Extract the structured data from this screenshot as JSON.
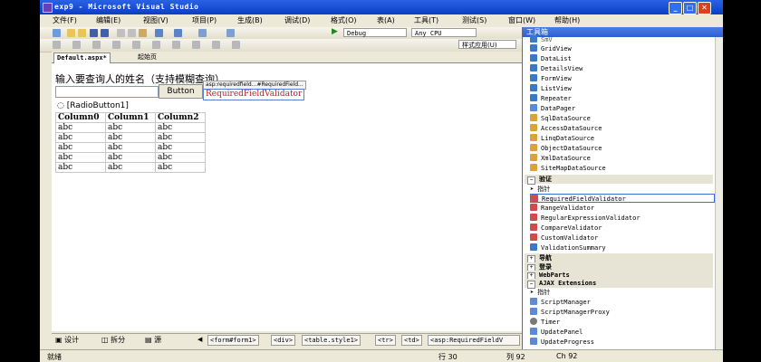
{
  "window": {
    "title": "exp9 - Microsoft Visual Studio"
  },
  "menu": [
    "文件(F)",
    "编辑(E)",
    "视图(V)",
    "项目(P)",
    "生成(B)",
    "调试(D)",
    "格式(O)",
    "表(A)",
    "工具(T)",
    "测试(S)",
    "窗口(W)",
    "帮助(H)"
  ],
  "toolbar": {
    "config": "Debug",
    "platform": "Any CPU",
    "style_app": "样式应用(U)"
  },
  "tabs": [
    "Default.aspx*",
    "起始页"
  ],
  "design": {
    "prompt": "输入要查询人的姓名（支持模糊查询）",
    "button": "Button",
    "validator_tag": "asp:requiredfield...#RequiredField...",
    "validator_text": "RequiredFieldValidator",
    "radio": "[RadioButton1]",
    "table_headers": [
      "Column0",
      "Column1",
      "Column2"
    ],
    "table_rows": [
      [
        "abc",
        "abc",
        "abc"
      ],
      [
        "abc",
        "abc",
        "abc"
      ],
      [
        "abc",
        "abc",
        "abc"
      ],
      [
        "abc",
        "abc",
        "abc"
      ],
      [
        "abc",
        "abc",
        "abc"
      ]
    ]
  },
  "view_tabs": [
    "设计",
    "拆分",
    "源"
  ],
  "breadcrumbs": [
    "<form#form1>",
    "<div>",
    "<table.style1>",
    "<tr>",
    "<td>",
    "<asp:RequiredFieldV"
  ],
  "status": {
    "ready": "就绪",
    "line": "行 30",
    "col": "列 92",
    "ch": "Ch 92"
  },
  "toolbox": {
    "title": "工具箱",
    "partial_top": "SmV",
    "data_items": [
      {
        "label": "GridView",
        "color": "#3a78c8"
      },
      {
        "label": "DataList",
        "color": "#3a78c8"
      },
      {
        "label": "DetailsView",
        "color": "#3a78c8"
      },
      {
        "label": "FormView",
        "color": "#3a78c8"
      },
      {
        "label": "ListView",
        "color": "#3a78c8"
      },
      {
        "label": "Repeater",
        "color": "#3a78c8"
      },
      {
        "label": "DataPager",
        "color": "#5a8ad8"
      },
      {
        "label": "SqlDataSource",
        "color": "#d9a23a"
      },
      {
        "label": "AccessDataSource",
        "color": "#d9a23a"
      },
      {
        "label": "LinqDataSource",
        "color": "#d9a23a"
      },
      {
        "label": "ObjectDataSource",
        "color": "#d9a23a"
      },
      {
        "label": "XmlDataSource",
        "color": "#d9a23a"
      },
      {
        "label": "SiteMapDataSource",
        "color": "#d9a23a"
      }
    ],
    "validation_group": "验证",
    "validation_items": [
      {
        "label": "指针",
        "color": "#333"
      },
      {
        "label": "RequiredFieldValidator",
        "color": "#d24b4b"
      },
      {
        "label": "RangeValidator",
        "color": "#d24b4b"
      },
      {
        "label": "RegularExpressionValidator",
        "color": "#d24b4b"
      },
      {
        "label": "CompareValidator",
        "color": "#d24b4b"
      },
      {
        "label": "CustomValidator",
        "color": "#d24b4b"
      },
      {
        "label": "ValidationSummary",
        "color": "#3a78c8"
      }
    ],
    "collapsed_groups": [
      "导航",
      "登录",
      "WebParts"
    ],
    "ajax_group": "AJAX Extensions",
    "ajax_items": [
      {
        "label": "指针",
        "color": "#333"
      },
      {
        "label": "ScriptManager",
        "color": "#5a8ad8"
      },
      {
        "label": "ScriptManagerProxy",
        "color": "#5a8ad8"
      },
      {
        "label": "Timer",
        "color": "#7a7a7a"
      },
      {
        "label": "UpdatePanel",
        "color": "#5a8ad8"
      },
      {
        "label": "UpdateProgress",
        "color": "#5a8ad8"
      }
    ]
  }
}
